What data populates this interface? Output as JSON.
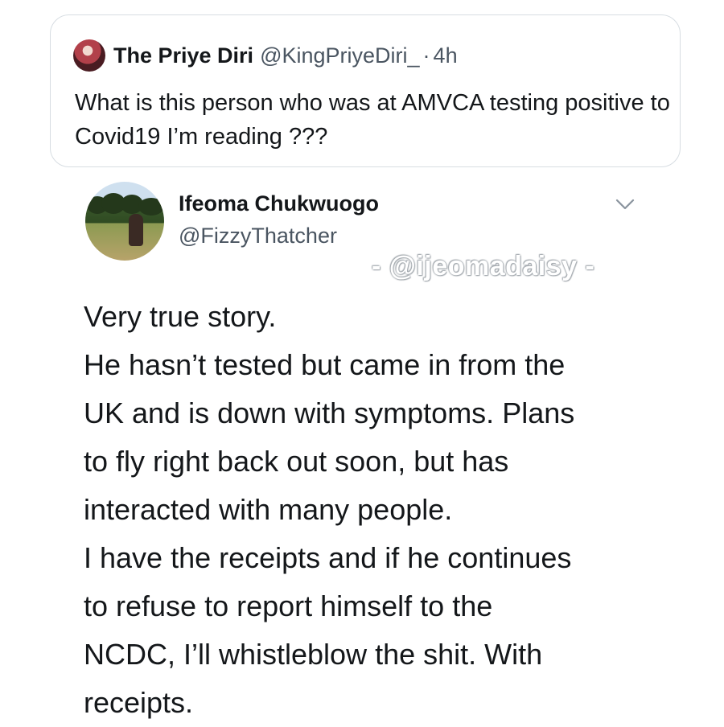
{
  "quoted_tweet": {
    "display_name": "The Priye Diri",
    "handle": "@KingPriyeDiri_",
    "separator": "·",
    "time": "4h",
    "text": "What is this person who was at AMVCA testing positive to Covid19 I’m reading ???"
  },
  "tweet": {
    "display_name": "Ifeoma Chukwuogo",
    "handle": "@FizzyThatcher",
    "menu_icon": "chevron-down-icon",
    "watermark": "- @ijeomadaisy -",
    "body_lines": [
      "Very true story.",
      "He hasn’t tested but came in from the",
      "UK and is down with symptoms. Plans",
      "to fly right back out soon, but has",
      "interacted with many people.",
      "I have the receipts and if he continues",
      "to refuse to report himself to the",
      "NCDC, I’ll whistleblow the shit. With",
      "receipts."
    ]
  },
  "colors": {
    "primary_text": "#14171a",
    "secondary_text": "#4a5561",
    "card_border": "#d7dde2"
  }
}
